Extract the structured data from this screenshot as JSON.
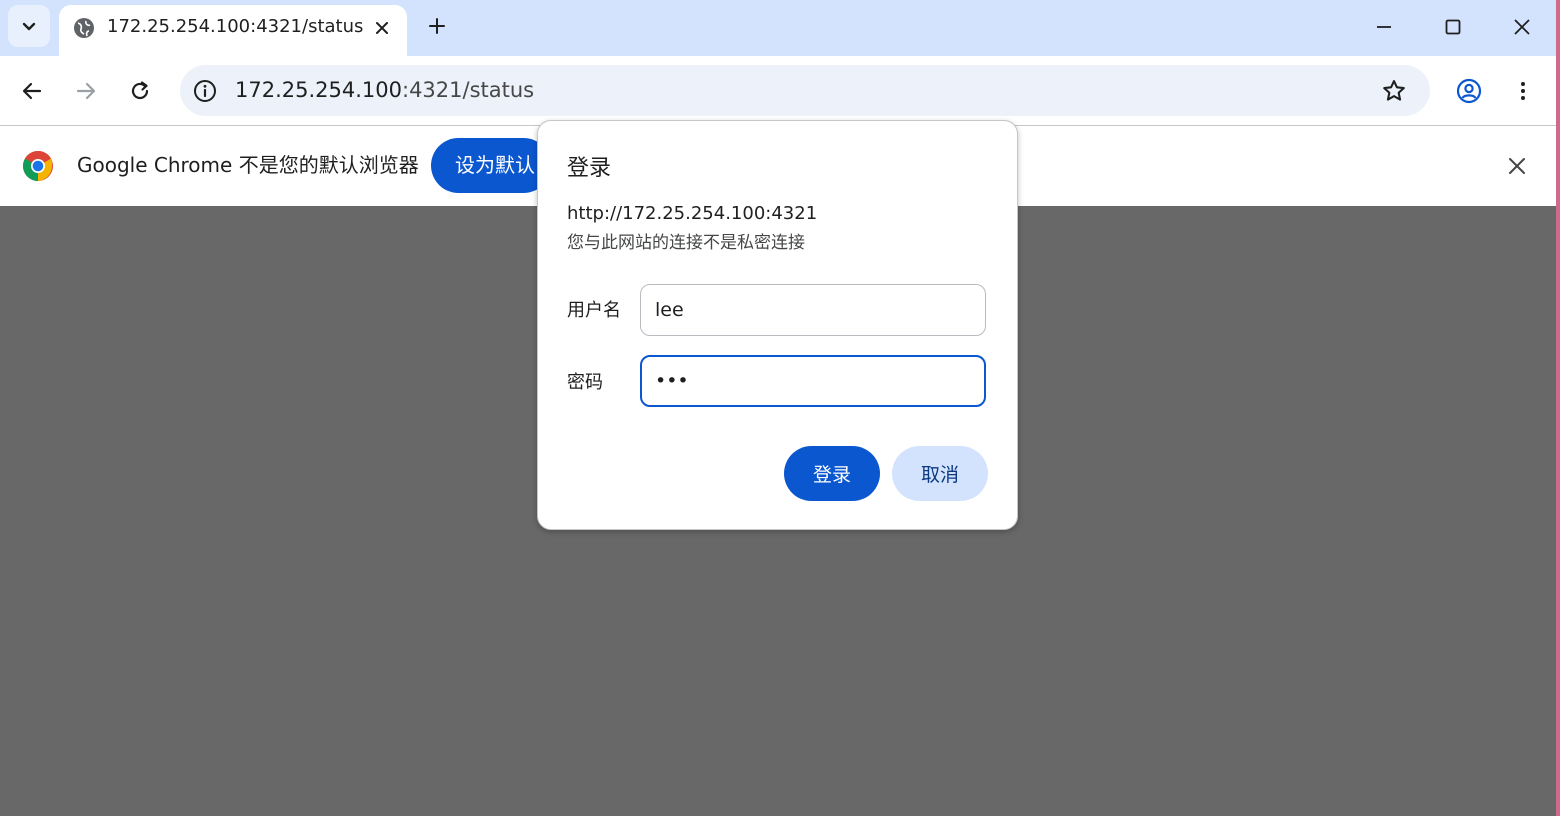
{
  "tab": {
    "title": "172.25.254.100:4321/status"
  },
  "omnibox": {
    "host": "172.25.254.100",
    "rest": ":4321/status"
  },
  "infobar": {
    "message": "Google Chrome 不是您的默认浏览器",
    "button_label": "设为默认"
  },
  "dialog": {
    "title": "登录",
    "origin": "http://172.25.254.100:4321",
    "warning": "您与此网站的连接不是私密连接",
    "username_label": "用户名",
    "username_value": "lee",
    "password_label": "密码",
    "password_value": "•••",
    "login_button": "登录",
    "cancel_button": "取消"
  },
  "colors": {
    "accent": "#0b57d0",
    "tabstrip": "#d3e3fd",
    "page_overlay": "#686868"
  }
}
